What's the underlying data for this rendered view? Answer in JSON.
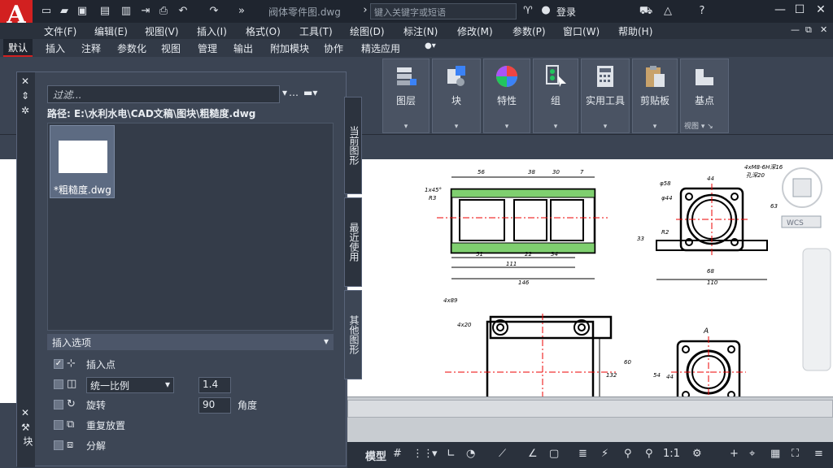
{
  "titlebar": {
    "logo": "A",
    "doc_title": "阀体零件图.dwg",
    "search_placeholder": "键入关键字或短语",
    "login": "登录"
  },
  "menu": [
    "文件(F)",
    "编辑(E)",
    "视图(V)",
    "插入(I)",
    "格式(O)",
    "工具(T)",
    "绘图(D)",
    "标注(N)",
    "修改(M)",
    "参数(P)",
    "窗口(W)",
    "帮助(H)"
  ],
  "tabs": [
    "默认",
    "插入",
    "注释",
    "参数化",
    "视图",
    "管理",
    "输出",
    "附加模块",
    "协作",
    "精选应用"
  ],
  "ribbon": {
    "panels": [
      {
        "label": "图层",
        "icon": "layers-icon"
      },
      {
        "label": "块",
        "icon": "block-icon"
      },
      {
        "label": "特性",
        "icon": "properties-icon"
      },
      {
        "label": "组",
        "icon": "group-icon"
      },
      {
        "label": "实用工具",
        "icon": "calculator-icon"
      },
      {
        "label": "剪贴板",
        "icon": "clipboard-icon"
      },
      {
        "label": "基点",
        "icon": "basepoint-icon"
      }
    ],
    "view_label": "视图"
  },
  "palette": {
    "filter_placeholder": "过滤...",
    "path": "路径: E:\\水利水电\\CAD文稿\\图块\\粗糙度.dwg",
    "thumb_caption": "*粗糙度.dwg",
    "insert_options_title": "插入选项",
    "options": {
      "insert_point": "插入点",
      "uniform_scale": "统一比例",
      "scale_value": "1.4",
      "rotate": "旋转",
      "rotate_value": "90",
      "angle_unit": "角度",
      "repeat": "重复放置",
      "explode": "分解"
    },
    "side_tabs": [
      "当前图形",
      "最近使用",
      "其他图形"
    ],
    "side_label": "块"
  },
  "drawing": {
    "wcs": "WCS",
    "labels": [
      "56",
      "38",
      "30",
      "7",
      "1x45°",
      "R3",
      "111",
      "146",
      "51",
      "22",
      "34",
      "4xM8-6H深16",
      "孔深20",
      "44",
      "68",
      "110",
      "63",
      "33",
      "4x89",
      "4x20",
      "A",
      "132",
      "54",
      "60",
      "44",
      "φ58",
      "φ44",
      "R2"
    ]
  },
  "statusbar": {
    "model": "模型",
    "scale": "1:1"
  }
}
